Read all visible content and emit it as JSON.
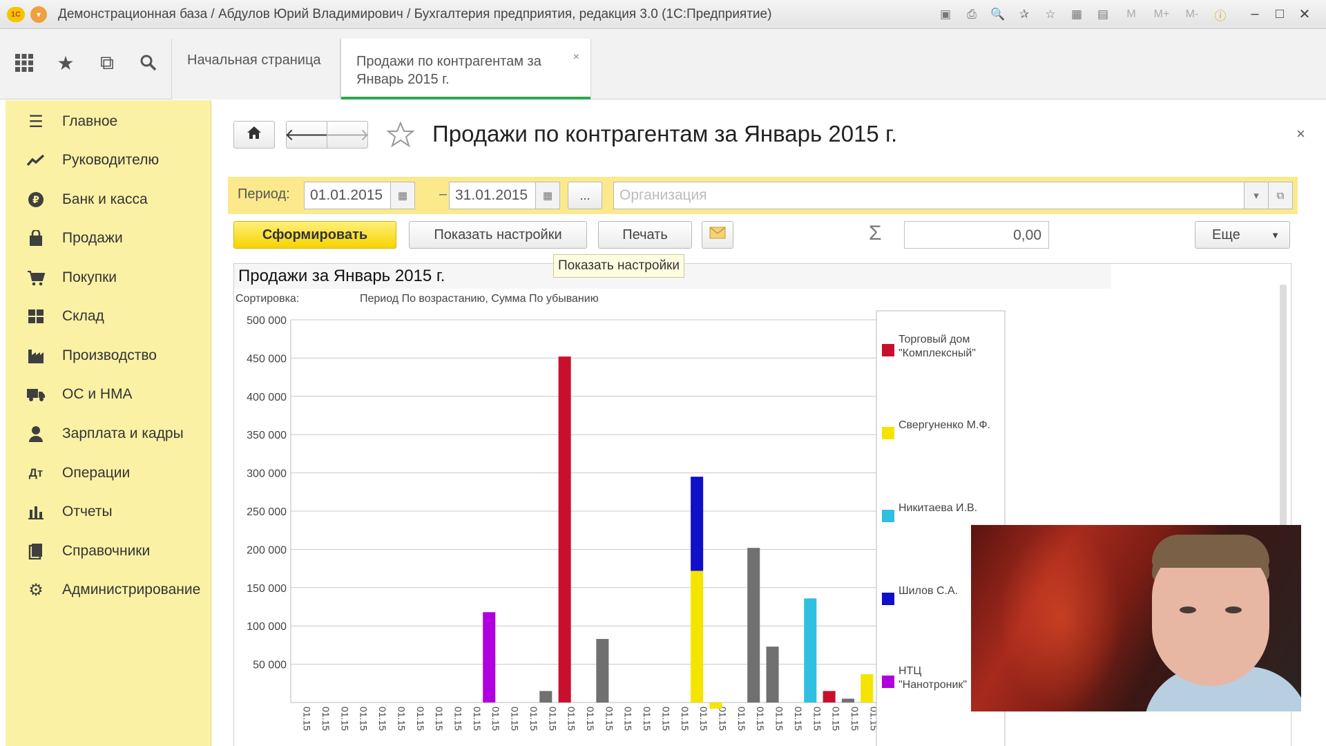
{
  "window": {
    "title": "Демонстрационная база / Абдулов Юрий Владимирович / Бухгалтерия предприятия, редакция 3.0  (1С:Предприятие)",
    "app_badge": "1С",
    "tools": [
      "save-icon",
      "print-icon",
      "preview-icon",
      "favorites-add-icon",
      "favorites-icon",
      "calculator-icon",
      "calendar-icon"
    ],
    "memory_labels": [
      "M",
      "M+",
      "M-"
    ]
  },
  "tabs": {
    "home_label": "Начальная страница",
    "active_label": "Продажи по контрагентам за Январь 2015 г.",
    "close_glyph": "×"
  },
  "sidebar": {
    "items": [
      {
        "label": "Главное",
        "icon": "menu-lines-icon"
      },
      {
        "label": "Руководителю",
        "icon": "trend-icon"
      },
      {
        "label": "Банк и касса",
        "icon": "ruble-icon"
      },
      {
        "label": "Продажи",
        "icon": "bag-icon"
      },
      {
        "label": "Покупки",
        "icon": "cart-icon"
      },
      {
        "label": "Склад",
        "icon": "warehouse-icon"
      },
      {
        "label": "Производство",
        "icon": "factory-icon"
      },
      {
        "label": "ОС и НМА",
        "icon": "truck-icon"
      },
      {
        "label": "Зарплата и кадры",
        "icon": "person-icon"
      },
      {
        "label": "Операции",
        "icon": "operations-icon"
      },
      {
        "label": "Отчеты",
        "icon": "bar-chart-icon"
      },
      {
        "label": "Справочники",
        "icon": "book-icon"
      },
      {
        "label": "Администрирование",
        "icon": "gear-icon"
      }
    ]
  },
  "page": {
    "title": "Продажи по контрагентам за Январь 2015 г.",
    "close_glyph": "×"
  },
  "filters": {
    "period_label": "Период:",
    "date_from": "01.01.2015",
    "date_to": "31.01.2015",
    "dash": "–",
    "ellipsis": "...",
    "org_placeholder": "Организация"
  },
  "actions": {
    "generate": "Сформировать",
    "show_settings": "Показать настройки",
    "print": "Печать",
    "sigma": "Σ",
    "sum_value": "0,00",
    "more": "Еще"
  },
  "tooltip": "Показать настройки",
  "report": {
    "title": "Продажи за Январь 2015 г.",
    "sort_label": "Сортировка:",
    "sort_value": "Период По возрастанию, Сумма По убыванию"
  },
  "chart_data": {
    "type": "bar",
    "stacked": true,
    "ylim": [
      0,
      500000
    ],
    "y_ticks": [
      "500 000",
      "450 000",
      "400 000",
      "350 000",
      "300 000",
      "250 000",
      "200 000",
      "150 000",
      "100 000",
      "50 000"
    ],
    "x_tick_label": "01.15",
    "legend_placement": "right",
    "series": [
      {
        "name": "Торговый дом \"Комплексный\"",
        "color": "#c8102e"
      },
      {
        "name": "Свергуненко М.Ф.",
        "color": "#f5e400"
      },
      {
        "name": "Никитаева И.В.",
        "color": "#2fbfe0"
      },
      {
        "name": "Шилов С.А.",
        "color": "#1010c8"
      },
      {
        "name": "НТЦ \"Нанотроник\"",
        "color": "#b000e0"
      }
    ],
    "bars": [
      {
        "slot": 10,
        "color": "#b000e0",
        "value": 118000
      },
      {
        "slot": 13,
        "color": "#707070",
        "value": 15000
      },
      {
        "slot": 14,
        "color": "#c8102e",
        "value": 452000
      },
      {
        "slot": 16,
        "color": "#707070",
        "value": 83000
      },
      {
        "slot": 21,
        "segments": [
          {
            "color": "#f5e400",
            "value": 172000
          },
          {
            "color": "#1010c8",
            "value": 123000
          }
        ]
      },
      {
        "slot": 22,
        "color": "#f5e400",
        "value": -8000
      },
      {
        "slot": 24,
        "color": "#707070",
        "value": 202000
      },
      {
        "slot": 25,
        "color": "#707070",
        "value": 73000
      },
      {
        "slot": 27,
        "color": "#2fbfe0",
        "value": 136000
      },
      {
        "slot": 28,
        "color": "#c8102e",
        "value": 15000
      },
      {
        "slot": 29,
        "color": "#707070",
        "value": 5000
      },
      {
        "slot": 30,
        "color": "#f5e400",
        "value": 37000
      }
    ]
  }
}
